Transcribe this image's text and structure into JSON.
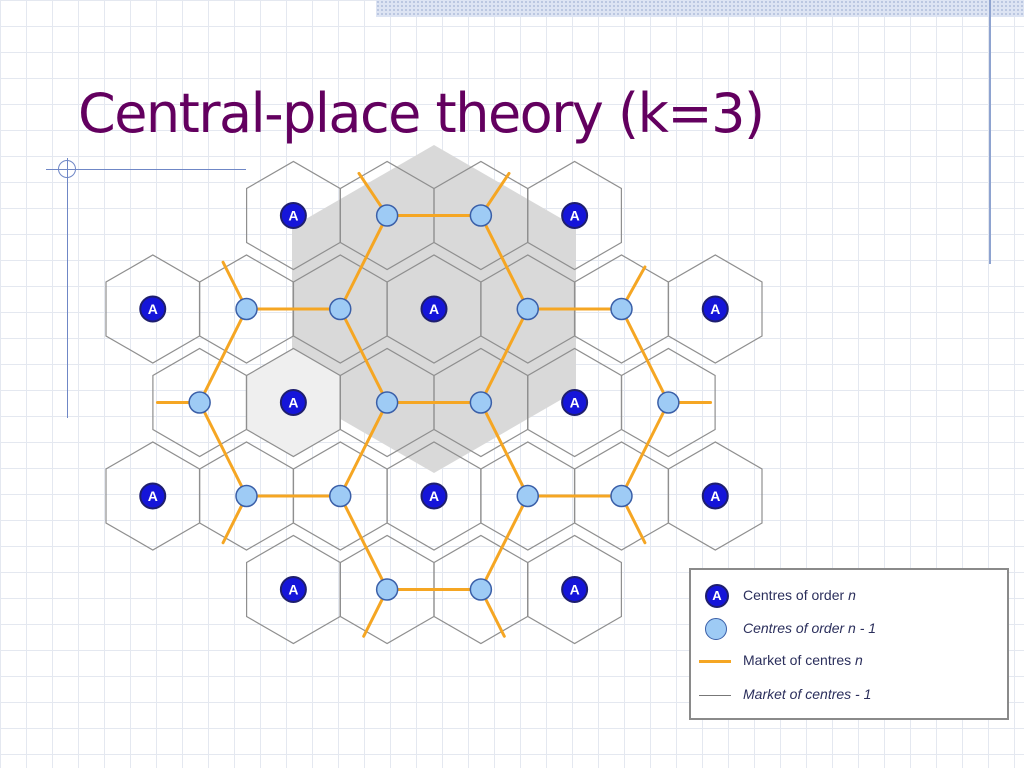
{
  "slide": {
    "title": "Central-place theory (k=3)"
  },
  "diagram": {
    "order_n_label": "A",
    "colors": {
      "hex_border": "#8f8f8f",
      "market_line": "#f5a623",
      "highlight_fill": "#d9d9d9",
      "order_n_fill": "#1515d9",
      "order_n_border": "#1e1e6e",
      "order_n1_fill": "#9ecbf5",
      "order_n1_border": "#3a5fa8"
    }
  },
  "legend": {
    "order_n_symbol": "A",
    "order_n_text": "Centres of order ",
    "order_n_italic": "n",
    "order_n1_text": "Centres of order n - 1",
    "market_n_text": "Market of centres ",
    "market_n_italic": "n",
    "market_n1_text": "Market of centres  - 1"
  }
}
